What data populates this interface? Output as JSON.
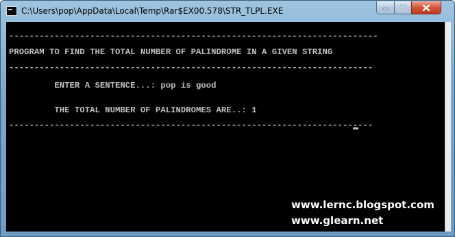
{
  "window": {
    "title": "C:\\Users\\pop\\AppData\\Local\\Temp\\Rar$EX00.578\\STR_TLPL.EXE",
    "icon": "console-icon",
    "controls": [
      "minimize-icon",
      "maximize-icon",
      "close-icon"
    ]
  },
  "console": {
    "lines": [
      "-------------------------------------------------------------------------",
      "PROGRAM TO FIND THE TOTAL NUMBER OF PALINDROME IN A GIVEN STRING",
      "------------------------------------------------------------------------",
      "         ENTER A SENTENCE...: pop is good",
      "         THE TOTAL NUMBER OF PALINDROMES ARE..: 1",
      "------------------------------------------------------------------------"
    ]
  },
  "watermarks": [
    "www.lernc.blogspot.com",
    "www.glearn.net"
  ]
}
